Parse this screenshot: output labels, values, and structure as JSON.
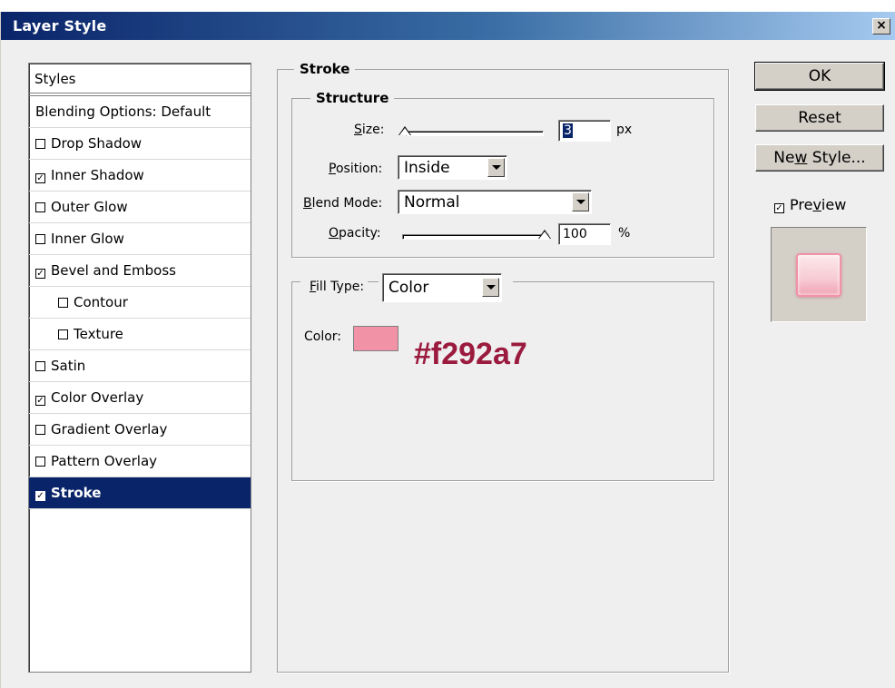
{
  "window": {
    "title": "Layer Style",
    "close_label": "×"
  },
  "styles_list": {
    "header": "Styles",
    "blending_options": "Blending Options: Default",
    "items": [
      {
        "label": "Drop Shadow",
        "checked": false,
        "indent": false
      },
      {
        "label": "Inner Shadow",
        "checked": true,
        "indent": false
      },
      {
        "label": "Outer Glow",
        "checked": false,
        "indent": false
      },
      {
        "label": "Inner Glow",
        "checked": false,
        "indent": false
      },
      {
        "label": "Bevel and Emboss",
        "checked": true,
        "indent": false
      },
      {
        "label": "Contour",
        "checked": false,
        "indent": true
      },
      {
        "label": "Texture",
        "checked": false,
        "indent": true
      },
      {
        "label": "Satin",
        "checked": false,
        "indent": false
      },
      {
        "label": "Color Overlay",
        "checked": true,
        "indent": false
      },
      {
        "label": "Gradient Overlay",
        "checked": false,
        "indent": false
      },
      {
        "label": "Pattern Overlay",
        "checked": false,
        "indent": false
      },
      {
        "label": "Stroke",
        "checked": true,
        "indent": false,
        "selected": true
      }
    ]
  },
  "stroke": {
    "group_title": "Stroke",
    "structure": {
      "group_title": "Structure",
      "size_label_u": "S",
      "size_label_rest": "ize:",
      "size_value": "3",
      "size_unit": "px",
      "position_label_u": "P",
      "position_label_rest": "osition:",
      "position_value": "Inside",
      "blend_label_u": "B",
      "blend_label_rest": "lend Mode:",
      "blend_value": "Normal",
      "opacity_label_u": "O",
      "opacity_label_rest": "pacity:",
      "opacity_value": "100",
      "opacity_unit": "%"
    },
    "fill": {
      "type_label_u": "F",
      "type_label_rest": "ill Type:",
      "type_value": "Color",
      "color_label": "Color:",
      "color_hex": "#f292a7",
      "color_annotation": "#f292a7"
    }
  },
  "buttons": {
    "ok": "OK",
    "reset": "Reset",
    "new_style_pre": "Ne",
    "new_style_u": "w",
    "new_style_post": " Style...",
    "preview_pre": "Pre",
    "preview_u": "v",
    "preview_post": "iew",
    "preview_checked": true
  },
  "colors": {
    "title_bar": "#0a246a",
    "selection": "#0a246a",
    "stroke_color": "#f292a7",
    "annotation": "#9b1b3e"
  }
}
